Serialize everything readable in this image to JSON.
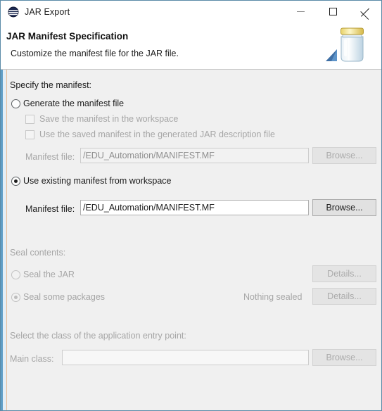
{
  "window": {
    "title": "JAR Export",
    "icon": "jar-export-icon",
    "controls": {
      "minimize": "minimize-icon",
      "maximize": "maximize-icon",
      "close": "close-icon"
    }
  },
  "header": {
    "title": "JAR Manifest Specification",
    "subtitle": "Customize the manifest file for the JAR file.",
    "art": "jar-with-arrow-icon"
  },
  "manifest_section": {
    "group_label": "Specify the manifest:",
    "generate_option": {
      "label": "Generate the manifest file",
      "selected": false
    },
    "save_in_workspace": {
      "label": "Save the manifest in the workspace",
      "checked": false,
      "enabled": false
    },
    "use_saved_in_description": {
      "label": "Use the saved manifest in the generated JAR description file",
      "checked": false,
      "enabled": false
    },
    "generate_manifest_file": {
      "label": "Manifest file:",
      "value": "/EDU_Automation/MANIFEST.MF",
      "browse_label": "Browse...",
      "enabled": false
    },
    "use_existing_option": {
      "label": "Use existing manifest from workspace",
      "selected": true
    },
    "existing_manifest_file": {
      "label": "Manifest file:",
      "value": "/EDU_Automation/MANIFEST.MF",
      "browse_label": "Browse...",
      "enabled": true
    }
  },
  "seal_section": {
    "group_label": "Seal contents:",
    "seal_jar": {
      "label": "Seal the JAR",
      "selected": false,
      "details_label": "Details...",
      "enabled": false
    },
    "seal_packages": {
      "label": "Seal some packages",
      "selected": true,
      "status": "Nothing sealed",
      "details_label": "Details...",
      "enabled": false
    }
  },
  "entry_point_section": {
    "group_label": "Select the class of the application entry point:",
    "main_class": {
      "label": "Main class:",
      "value": "",
      "browse_label": "Browse...",
      "enabled": false
    }
  },
  "colors": {
    "accent_rail": "#5f9ec6",
    "tan_rail": "#e8bf9a",
    "window_border": "#5a8ba8",
    "body_bg": "#f0f0f0",
    "disabled_text": "#a6a6a6"
  }
}
